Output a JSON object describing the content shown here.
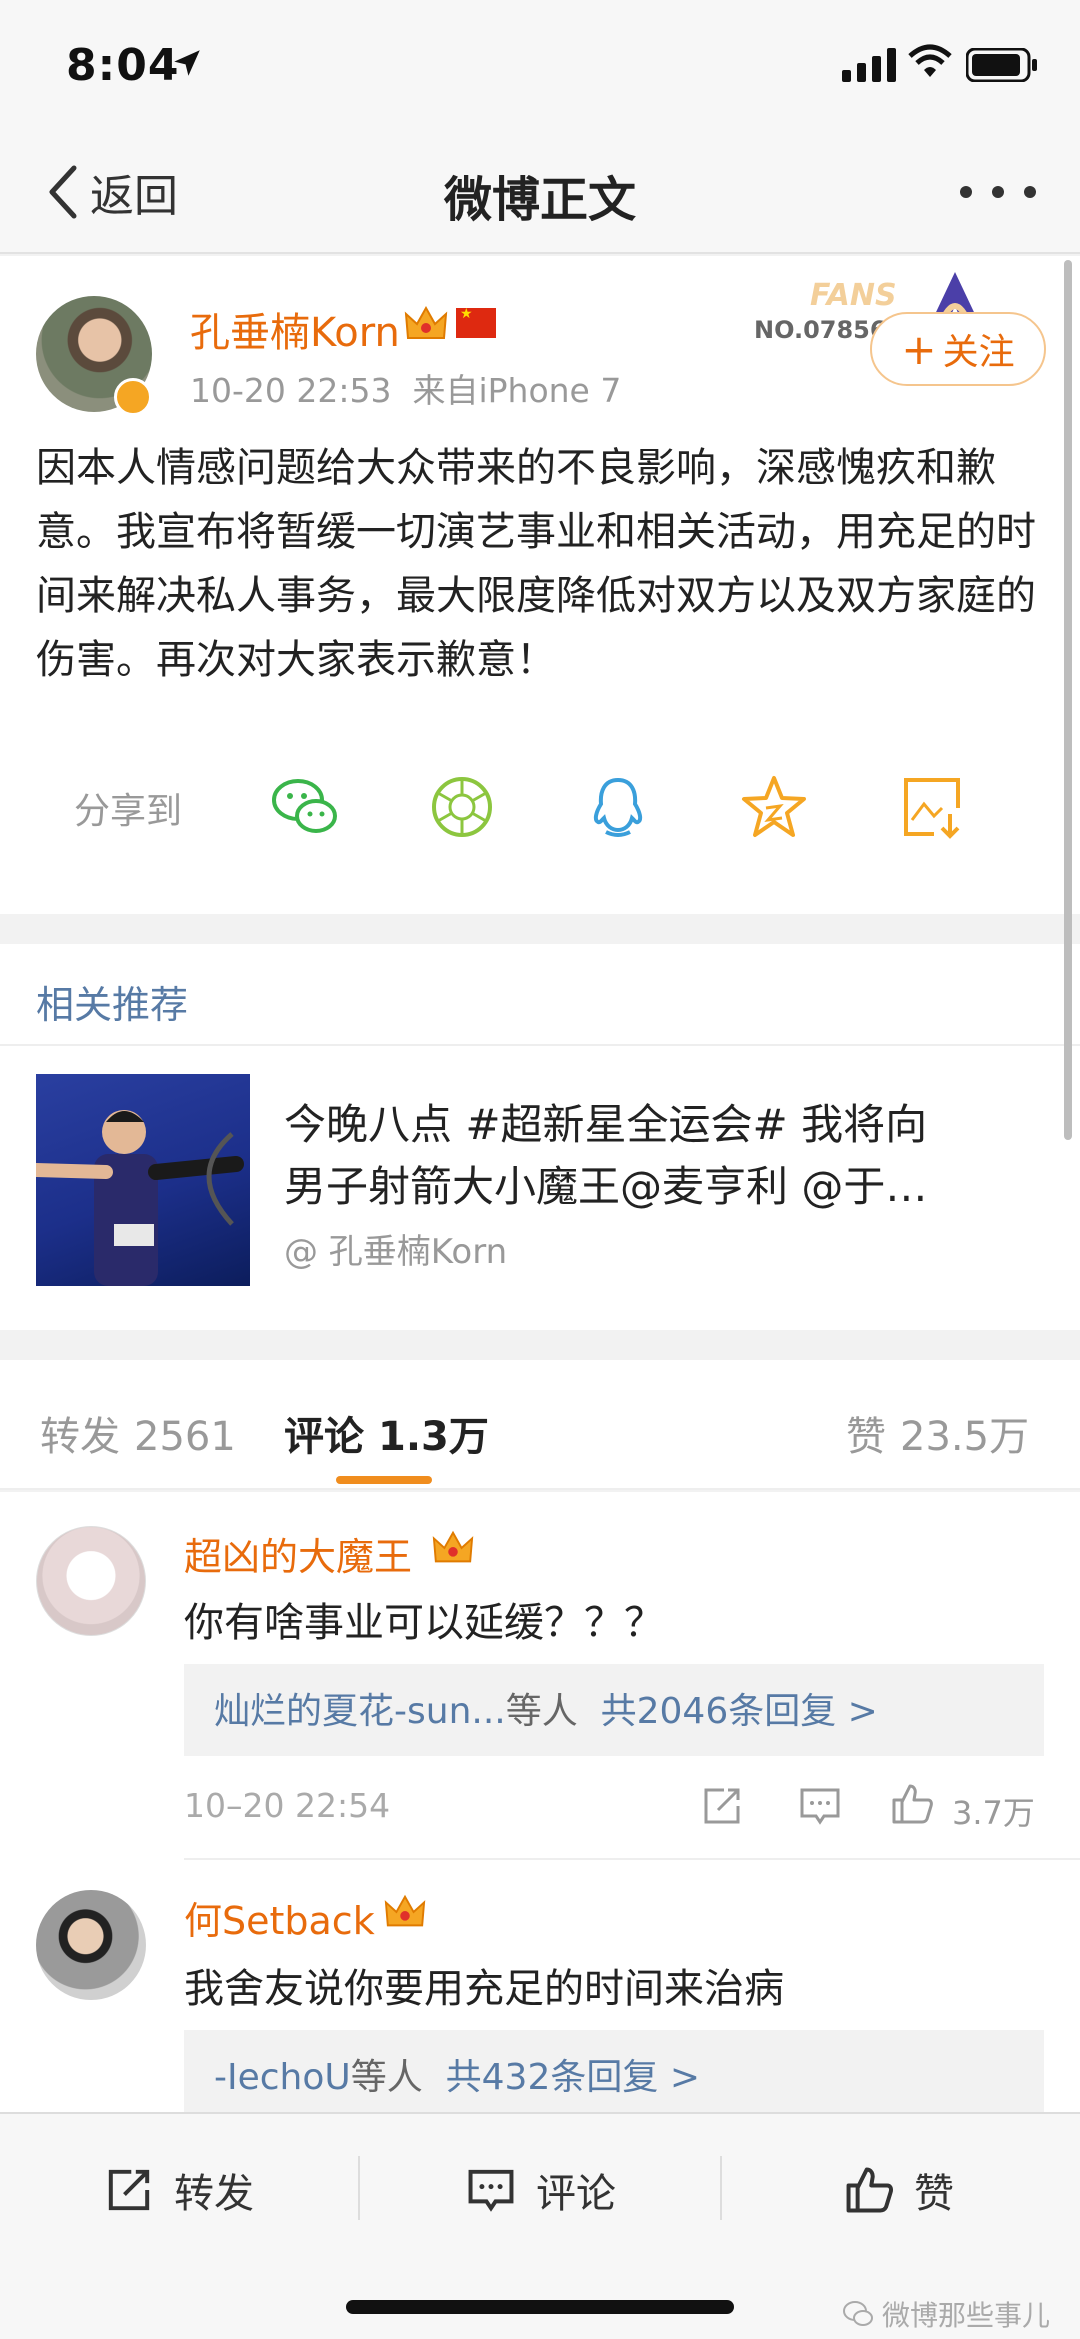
{
  "status_bar": {
    "time": "8:04"
  },
  "nav": {
    "back_label": "返回",
    "title": "微博正文"
  },
  "post": {
    "username": "孔垂楠Korn",
    "timestamp": "10-20 22:53",
    "source": "来自iPhone 7",
    "fans_badge": {
      "word": "FANS",
      "number": "NO.07856"
    },
    "follow_label": "关注",
    "content": "因本人情感问题给大众带来的不良影响，深感愧疚和歉意。我宣布将暂缓一切演艺事业和相关活动，用充足的时间来解决私人事务，最大限度降低对双方以及双方家庭的伤害。再次对大家表示歉意！",
    "share_label": "分享到",
    "share_icons": [
      "wechat-icon",
      "moments-icon",
      "qq-icon",
      "favorite-star-icon",
      "save-image-icon"
    ]
  },
  "related": {
    "title": "相关推荐",
    "line1": "今晚八点 #超新星全运会# 我将向",
    "line2": "男子射箭大小魔王@麦亨利 @于…",
    "source": "@ 孔垂楠Korn"
  },
  "tabs": {
    "repost_label": "转发",
    "repost_count": "2561",
    "comment_label": "评论",
    "comment_count": "1.3万",
    "like_label": "赞",
    "like_count": "23.5万"
  },
  "comments": [
    {
      "name": "超凶的大魔王",
      "text": "你有啥事业可以延缓？？？",
      "reply_from": "灿烂的夏花-sun...",
      "reply_by": "等人",
      "reply_total": "共2046条回复 >",
      "time": "10–20 22:54",
      "likes": "3.7万"
    },
    {
      "name": "何Setback",
      "text": "我舍友说你要用充足的时间来治病",
      "reply_from": "-IechoU",
      "reply_by": "等人",
      "reply_total": "共432条回复 >"
    }
  ],
  "bottom_bar": {
    "repost_label": "转发",
    "comment_label": "评论",
    "like_label": "赞"
  },
  "watermark": "微博那些事儿",
  "colors": {
    "accent_orange": "#e86b0c",
    "link_blue": "#577aa5",
    "tab_underline": "#f08d1e"
  }
}
